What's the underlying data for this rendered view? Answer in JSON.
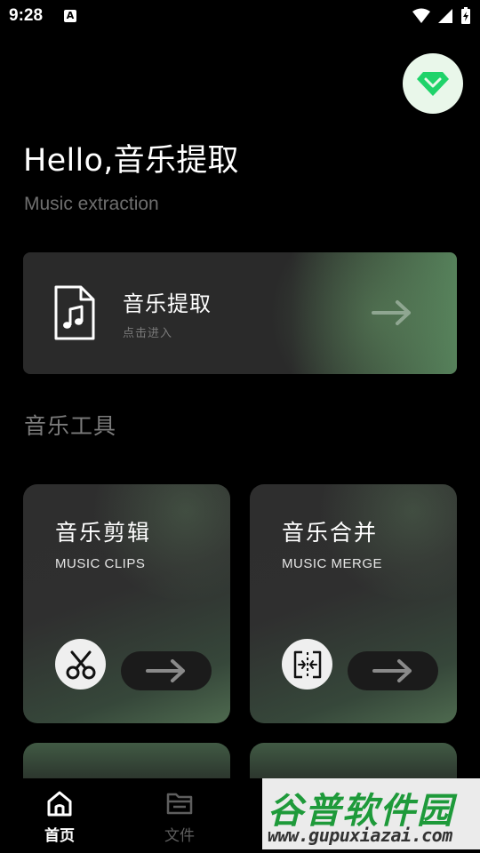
{
  "status_bar": {
    "time": "9:28",
    "notification_badge": "A"
  },
  "header": {
    "greeting": "Hello,音乐提取",
    "subtitle": "Music extraction"
  },
  "main_card": {
    "title": "音乐提取",
    "hint": "点击进入",
    "icon": "music-file-icon"
  },
  "section": {
    "title": "音乐工具"
  },
  "tools": [
    {
      "title": "音乐剪辑",
      "subtitle": "MUSIC CLIPS",
      "icon": "scissors-icon"
    },
    {
      "title": "音乐合并",
      "subtitle": "MUSIC MERGE",
      "icon": "merge-icon"
    }
  ],
  "bottom_nav": {
    "items": [
      {
        "label": "首页",
        "icon": "home-icon",
        "active": true
      },
      {
        "label": "文件",
        "icon": "folder-icon",
        "active": false
      }
    ]
  },
  "watermark": {
    "title": "谷普软件园",
    "url": "www.gupuxiazai.com"
  },
  "colors": {
    "background": "#000000",
    "accent_green": "#1fd36a",
    "card_gray": "#2a2a2a",
    "card_green": "#55805a"
  }
}
